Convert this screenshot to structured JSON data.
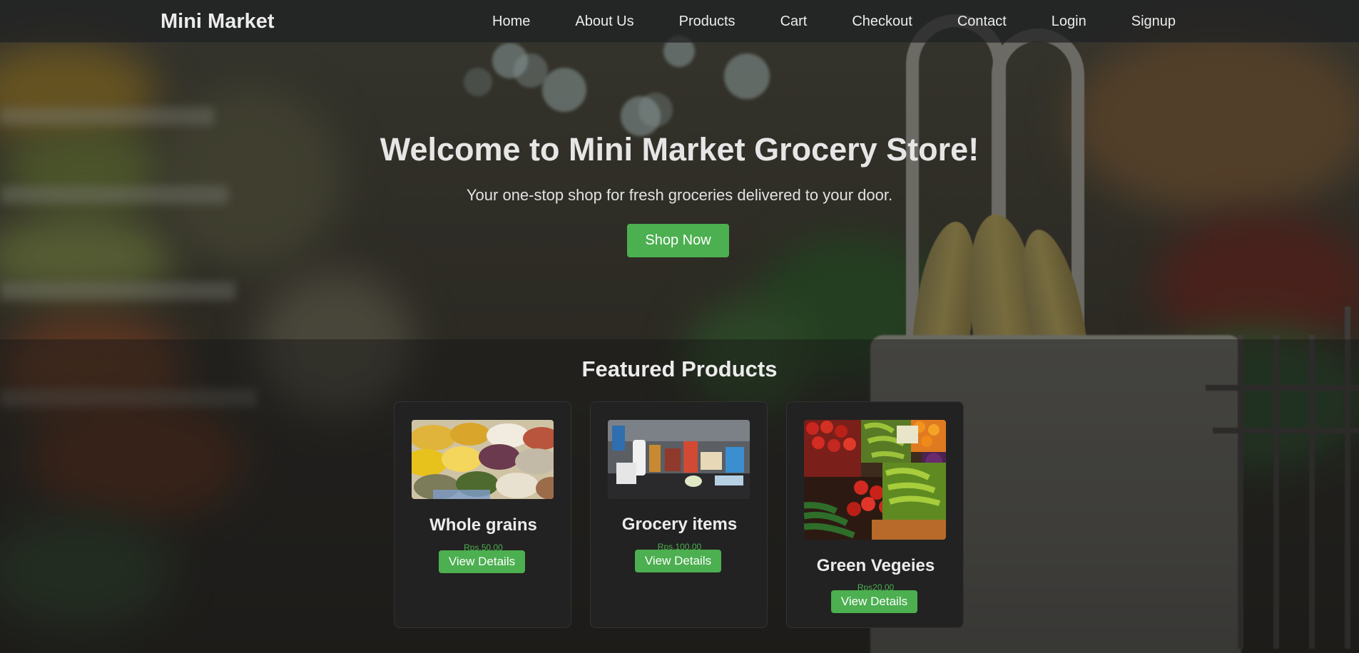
{
  "nav": {
    "brand": "Mini Market",
    "links": [
      {
        "label": "Home"
      },
      {
        "label": "About Us"
      },
      {
        "label": "Products"
      },
      {
        "label": "Cart"
      },
      {
        "label": "Checkout"
      },
      {
        "label": "Contact"
      },
      {
        "label": "Login"
      },
      {
        "label": "Signup"
      }
    ]
  },
  "hero": {
    "title": "Welcome to Mini Market Grocery Store!",
    "subtitle": "Your one-stop shop for fresh groceries delivered to your door.",
    "cta_label": "Shop Now"
  },
  "featured": {
    "heading": "Featured Products",
    "products": [
      {
        "name": "Whole grains",
        "price": "Rps.50.00",
        "button_label": "View Details",
        "image": "grain-sacks-photo"
      },
      {
        "name": "Grocery items",
        "price": "Rps.100.00",
        "button_label": "View Details",
        "image": "grocery-checkout-photo"
      },
      {
        "name": "Green Vegeies",
        "price": "Rps20.00",
        "button_label": "View Details",
        "image": "vegetable-stand-photo"
      }
    ]
  },
  "colors": {
    "accent": "#4caf50",
    "card_bg": "#222222",
    "nav_bg": "#1e2022"
  }
}
